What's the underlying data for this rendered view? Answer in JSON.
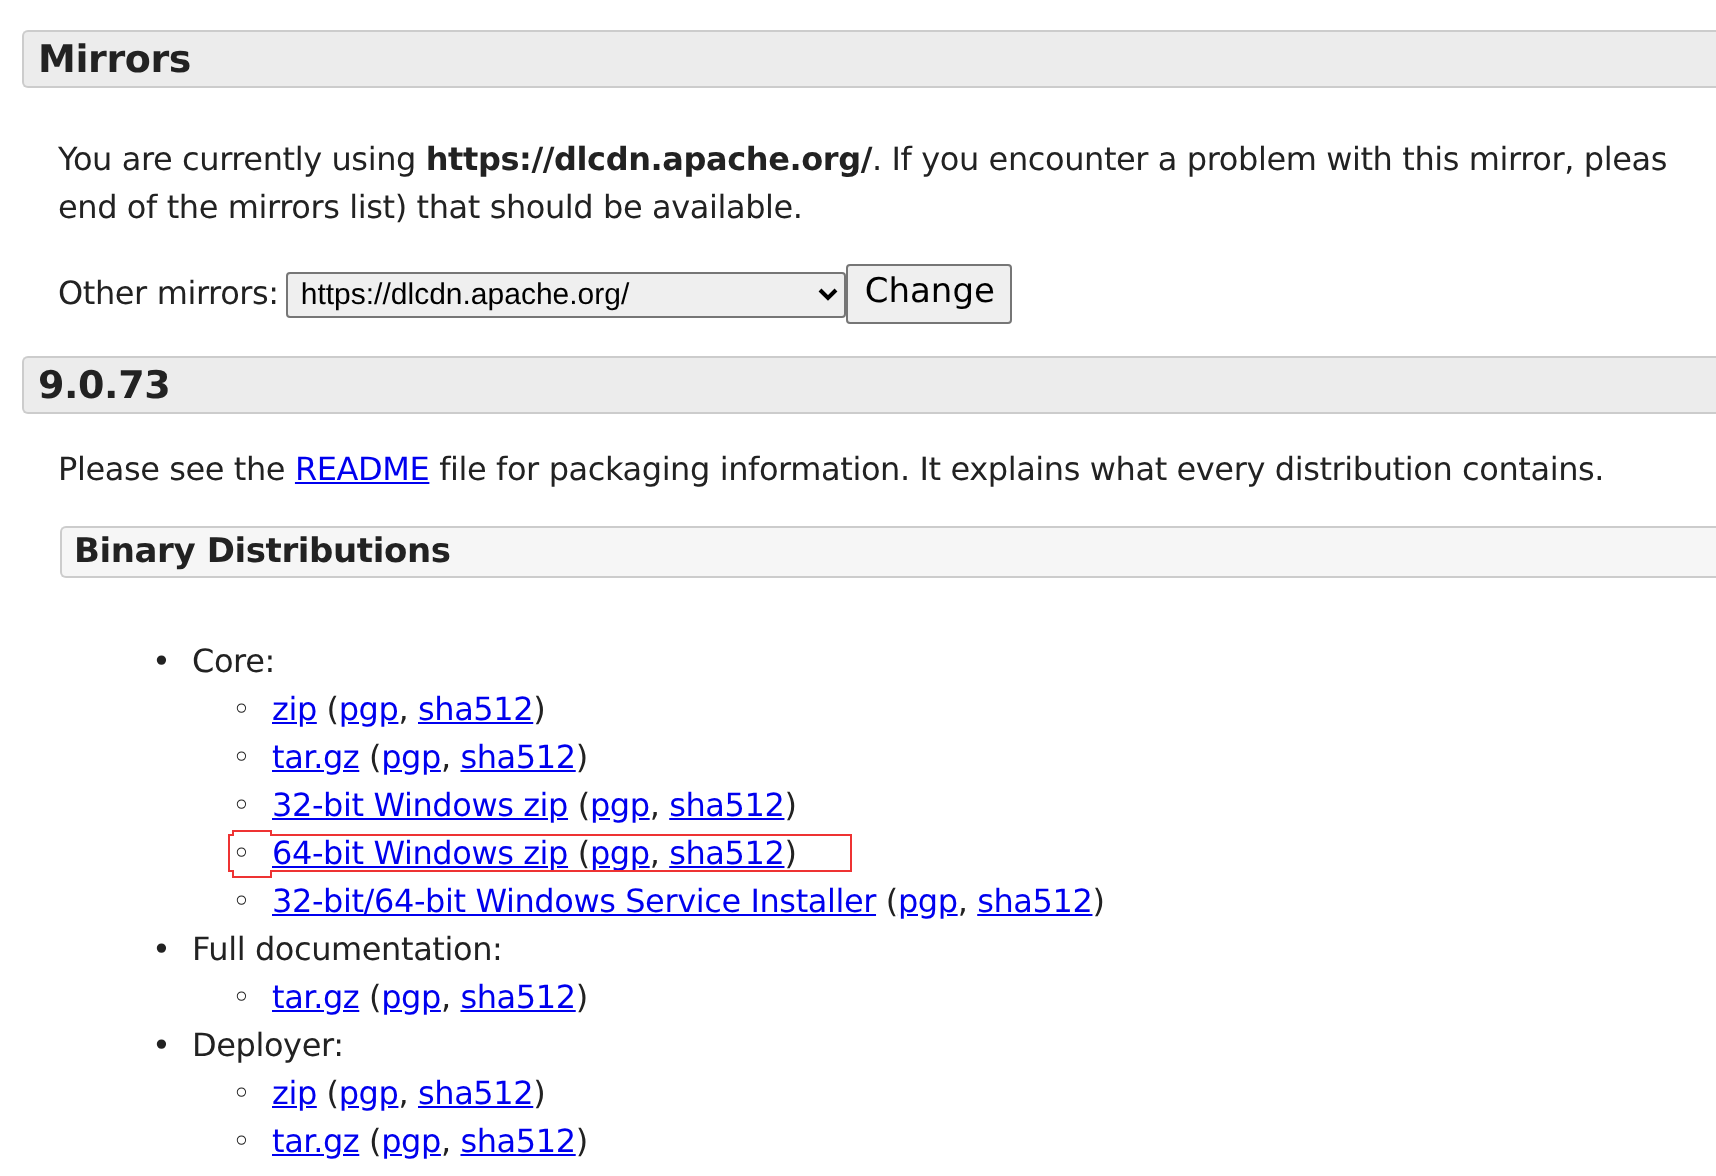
{
  "sections": [
    {
      "title": "Mirrors",
      "kind": "mirrors",
      "lines": [
        "You are currently using **https://dlcdn.apache.org/**. If you encounter a problem with this mirror, pleas",
        "end of the mirrors list) that should be available."
      ],
      "mirror_label": "Other mirrors:",
      "mirror_value": "https://dlcdn.apache.org/",
      "button": "Change"
    },
    {
      "title": "9.0.73",
      "kind": "release",
      "intro": {
        "before": "Please see the ",
        "link": "README",
        "after": " file for packaging information. It explains what every distribution contains."
      },
      "subsection": "Binary Distributions",
      "groups": [
        {
          "marker": "•",
          "label": "Core:",
          "items": [
            {
              "marker": "◦",
              "label": "zip",
              "open": " (",
              "signatures": [
                {
                  "label": "pgp",
                  "after": ", "
                },
                {
                  "label": "sha512",
                  "after": ")"
                }
              ],
              "highlighted": false
            },
            {
              "marker": "◦",
              "label": "tar.gz",
              "open": " (",
              "signatures": [
                {
                  "label": "pgp",
                  "after": ", "
                },
                {
                  "label": "sha512",
                  "after": ")"
                }
              ],
              "highlighted": false
            },
            {
              "marker": "◦",
              "label": "32-bit Windows zip",
              "open": " (",
              "signatures": [
                {
                  "label": "pgp",
                  "after": ", "
                },
                {
                  "label": "sha512",
                  "after": ")"
                }
              ],
              "highlighted": false
            },
            {
              "marker": "◦",
              "label": "64-bit Windows zip",
              "open": " (",
              "signatures": [
                {
                  "label": "pgp",
                  "after": ", "
                },
                {
                  "label": "sha512",
                  "after": ")"
                }
              ],
              "highlighted": true
            },
            {
              "marker": "◦",
              "label": "32-bit/64-bit Windows Service Installer",
              "open": " (",
              "signatures": [
                {
                  "label": "pgp",
                  "after": ", "
                },
                {
                  "label": "sha512",
                  "after": ")"
                }
              ],
              "highlighted": false
            }
          ]
        },
        {
          "marker": "•",
          "label": "Full documentation:",
          "items": [
            {
              "marker": "◦",
              "label": "tar.gz",
              "open": " (",
              "signatures": [
                {
                  "label": "pgp",
                  "after": ", "
                },
                {
                  "label": "sha512",
                  "after": ")"
                }
              ],
              "highlighted": false
            }
          ]
        },
        {
          "marker": "•",
          "label": "Deployer:",
          "items": [
            {
              "marker": "◦",
              "label": "zip",
              "open": " (",
              "signatures": [
                {
                  "label": "pgp",
                  "after": ", "
                },
                {
                  "label": "sha512",
                  "after": ")"
                }
              ],
              "highlighted": false
            },
            {
              "marker": "◦",
              "label": "tar.gz",
              "open": " (",
              "signatures": [
                {
                  "label": "pgp",
                  "after": ", "
                },
                {
                  "label": "sha512",
                  "after": ")"
                }
              ],
              "highlighted": false
            }
          ]
        }
      ]
    }
  ]
}
